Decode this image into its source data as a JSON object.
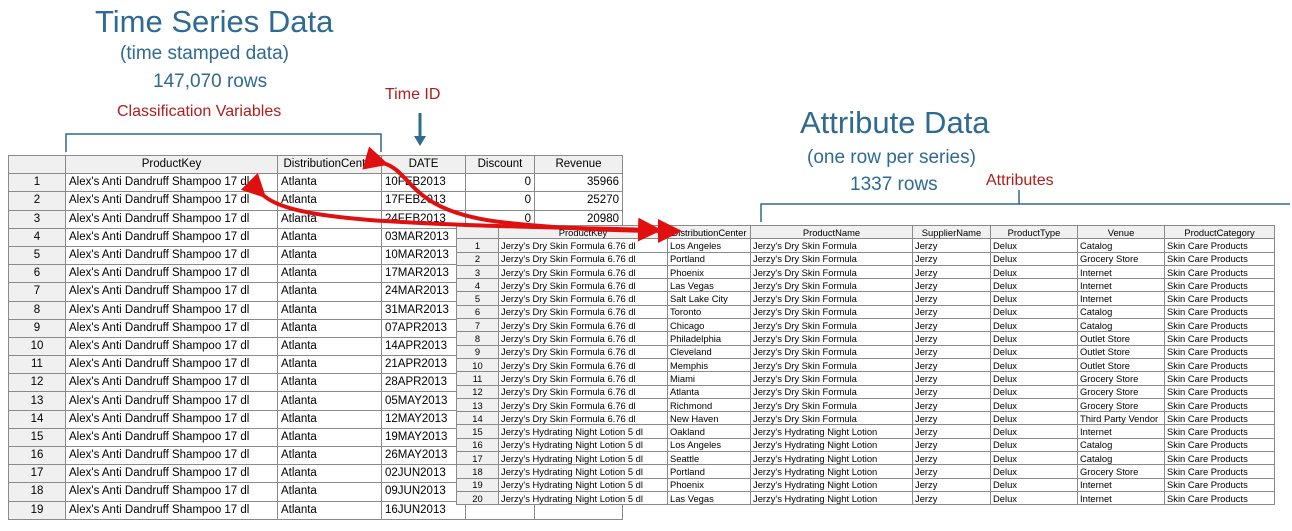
{
  "time_series": {
    "title": "Time Series Data",
    "subtitle": "(time stamped data)",
    "rows_label": "147,070 rows",
    "classification_label": "Classification Variables",
    "timeid_label": "Time ID",
    "columns": [
      "",
      "ProductKey",
      "DistributionCenter",
      "DATE",
      "Discount",
      "Revenue"
    ],
    "rows": [
      [
        "1",
        "Alex's Anti Dandruff Shampoo 17 dl",
        "Atlanta",
        "10FEB2013",
        "0",
        "35966"
      ],
      [
        "2",
        "Alex's Anti Dandruff Shampoo 17 dl",
        "Atlanta",
        "17FEB2013",
        "0",
        "25270"
      ],
      [
        "3",
        "Alex's Anti Dandruff Shampoo 17 dl",
        "Atlanta",
        "24FEB2013",
        "0",
        "20980"
      ],
      [
        "4",
        "Alex's Anti Dandruff Shampoo 17 dl",
        "Atlanta",
        "03MAR2013",
        "",
        ""
      ],
      [
        "5",
        "Alex's Anti Dandruff Shampoo 17 dl",
        "Atlanta",
        "10MAR2013",
        "",
        ""
      ],
      [
        "6",
        "Alex's Anti Dandruff Shampoo 17 dl",
        "Atlanta",
        "17MAR2013",
        "",
        ""
      ],
      [
        "7",
        "Alex's Anti Dandruff Shampoo 17 dl",
        "Atlanta",
        "24MAR2013",
        "",
        ""
      ],
      [
        "8",
        "Alex's Anti Dandruff Shampoo 17 dl",
        "Atlanta",
        "31MAR2013",
        "",
        ""
      ],
      [
        "9",
        "Alex's Anti Dandruff Shampoo 17 dl",
        "Atlanta",
        "07APR2013",
        "",
        ""
      ],
      [
        "10",
        "Alex's Anti Dandruff Shampoo 17 dl",
        "Atlanta",
        "14APR2013",
        "",
        ""
      ],
      [
        "11",
        "Alex's Anti Dandruff Shampoo 17 dl",
        "Atlanta",
        "21APR2013",
        "",
        ""
      ],
      [
        "12",
        "Alex's Anti Dandruff Shampoo 17 dl",
        "Atlanta",
        "28APR2013",
        "",
        ""
      ],
      [
        "13",
        "Alex's Anti Dandruff Shampoo 17 dl",
        "Atlanta",
        "05MAY2013",
        "",
        ""
      ],
      [
        "14",
        "Alex's Anti Dandruff Shampoo 17 dl",
        "Atlanta",
        "12MAY2013",
        "",
        ""
      ],
      [
        "15",
        "Alex's Anti Dandruff Shampoo 17 dl",
        "Atlanta",
        "19MAY2013",
        "",
        ""
      ],
      [
        "16",
        "Alex's Anti Dandruff Shampoo 17 dl",
        "Atlanta",
        "26MAY2013",
        "",
        ""
      ],
      [
        "17",
        "Alex's Anti Dandruff Shampoo 17 dl",
        "Atlanta",
        "02JUN2013",
        "",
        ""
      ],
      [
        "18",
        "Alex's Anti Dandruff Shampoo 17 dl",
        "Atlanta",
        "09JUN2013",
        "",
        ""
      ],
      [
        "19",
        "Alex's Anti Dandruff Shampoo 17 dl",
        "Atlanta",
        "16JUN2013",
        "",
        ""
      ]
    ]
  },
  "attribute": {
    "title": "Attribute Data",
    "subtitle": "(one row per series)",
    "rows_label": "1337 rows",
    "attributes_label": "Attributes",
    "columns": [
      "",
      "ProductKey",
      "DistributionCenter",
      "ProductName",
      "SupplierName",
      "ProductType",
      "Venue",
      "ProductCategory"
    ],
    "rows": [
      [
        "1",
        "Jerzy's Dry Skin Formula 6.76 dl",
        "Los Angeles",
        "Jerzy's Dry Skin Formula",
        "Jerzy",
        "Delux",
        "Catalog",
        "Skin Care Products"
      ],
      [
        "2",
        "Jerzy's Dry Skin Formula 6.76 dl",
        "Portland",
        "Jerzy's Dry Skin Formula",
        "Jerzy",
        "Delux",
        "Grocery Store",
        "Skin Care Products"
      ],
      [
        "3",
        "Jerzy's Dry Skin Formula 6.76 dl",
        "Phoenix",
        "Jerzy's Dry Skin Formula",
        "Jerzy",
        "Delux",
        "Internet",
        "Skin Care Products"
      ],
      [
        "4",
        "Jerzy's Dry Skin Formula 6.76 dl",
        "Las Vegas",
        "Jerzy's Dry Skin Formula",
        "Jerzy",
        "Delux",
        "Internet",
        "Skin Care Products"
      ],
      [
        "5",
        "Jerzy's Dry Skin Formula 6.76 dl",
        "Salt Lake City",
        "Jerzy's Dry Skin Formula",
        "Jerzy",
        "Delux",
        "Internet",
        "Skin Care Products"
      ],
      [
        "6",
        "Jerzy's Dry Skin Formula 6.76 dl",
        "Toronto",
        "Jerzy's Dry Skin Formula",
        "Jerzy",
        "Delux",
        "Catalog",
        "Skin Care Products"
      ],
      [
        "7",
        "Jerzy's Dry Skin Formula 6.76 dl",
        "Chicago",
        "Jerzy's Dry Skin Formula",
        "Jerzy",
        "Delux",
        "Catalog",
        "Skin Care Products"
      ],
      [
        "8",
        "Jerzy's Dry Skin Formula 6.76 dl",
        "Philadelphia",
        "Jerzy's Dry Skin Formula",
        "Jerzy",
        "Delux",
        "Outlet Store",
        "Skin Care Products"
      ],
      [
        "9",
        "Jerzy's Dry Skin Formula 6.76 dl",
        "Cleveland",
        "Jerzy's Dry Skin Formula",
        "Jerzy",
        "Delux",
        "Outlet Store",
        "Skin Care Products"
      ],
      [
        "10",
        "Jerzy's Dry Skin Formula 6.76 dl",
        "Memphis",
        "Jerzy's Dry Skin Formula",
        "Jerzy",
        "Delux",
        "Outlet Store",
        "Skin Care Products"
      ],
      [
        "11",
        "Jerzy's Dry Skin Formula 6.76 dl",
        "Miami",
        "Jerzy's Dry Skin Formula",
        "Jerzy",
        "Delux",
        "Grocery Store",
        "Skin Care Products"
      ],
      [
        "12",
        "Jerzy's Dry Skin Formula 6.76 dl",
        "Atlanta",
        "Jerzy's Dry Skin Formula",
        "Jerzy",
        "Delux",
        "Grocery Store",
        "Skin Care Products"
      ],
      [
        "13",
        "Jerzy's Dry Skin Formula 6.76 dl",
        "Richmond",
        "Jerzy's Dry Skin Formula",
        "Jerzy",
        "Delux",
        "Grocery Store",
        "Skin Care Products"
      ],
      [
        "14",
        "Jerzy's Dry Skin Formula 6.76 dl",
        "New Haven",
        "Jerzy's Dry Skin Formula",
        "Jerzy",
        "Delux",
        "Third Party Vendor",
        "Skin Care Products"
      ],
      [
        "15",
        "Jerzy's Hydrating Night Lotion 5 dl",
        "Oakland",
        "Jerzy's Hydrating Night Lotion",
        "Jerzy",
        "Delux",
        "Internet",
        "Skin Care Products"
      ],
      [
        "16",
        "Jerzy's Hydrating Night Lotion 5 dl",
        "Los Angeles",
        "Jerzy's Hydrating Night Lotion",
        "Jerzy",
        "Delux",
        "Catalog",
        "Skin Care Products"
      ],
      [
        "17",
        "Jerzy's Hydrating Night Lotion 5 dl",
        "Seattle",
        "Jerzy's Hydrating Night Lotion",
        "Jerzy",
        "Delux",
        "Catalog",
        "Skin Care Products"
      ],
      [
        "18",
        "Jerzy's Hydrating Night Lotion 5 dl",
        "Portland",
        "Jerzy's Hydrating Night Lotion",
        "Jerzy",
        "Delux",
        "Grocery Store",
        "Skin Care Products"
      ],
      [
        "19",
        "Jerzy's Hydrating Night Lotion 5 dl",
        "Phoenix",
        "Jerzy's Hydrating Night Lotion",
        "Jerzy",
        "Delux",
        "Internet",
        "Skin Care Products"
      ],
      [
        "20",
        "Jerzy's Hydrating Night Lotion 5 dl",
        "Las Vegas",
        "Jerzy's Hydrating Night Lotion",
        "Jerzy",
        "Delux",
        "Internet",
        "Skin Care Products"
      ]
    ]
  },
  "colors": {
    "title_blue": "#2e6a91",
    "label_red": "#b11d1d",
    "arrow_red": "#e01010"
  }
}
